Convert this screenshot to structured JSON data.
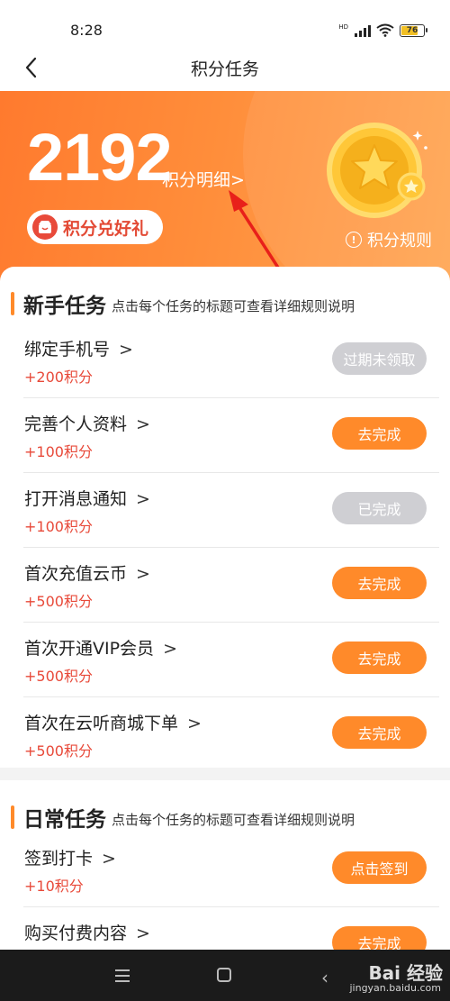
{
  "status_bar": {
    "time": "8:28",
    "battery": "76",
    "battery_level": 0.76,
    "network": "HD"
  },
  "nav": {
    "title": "积分任务"
  },
  "hero": {
    "points": "2192",
    "detail_link": "积分明细>",
    "gift_button": "积分兑好礼",
    "rules_link": "积分规则"
  },
  "sections": [
    {
      "title": "新手任务",
      "subtitle": "点击每个任务的标题可查看详细规则说明",
      "tasks": [
        {
          "title": "绑定手机号",
          "points": "+200积分",
          "button": "过期未领取",
          "state": "disabled"
        },
        {
          "title": "完善个人资料",
          "points": "+100积分",
          "button": "去完成",
          "state": "active"
        },
        {
          "title": "打开消息通知",
          "points": "+100积分",
          "button": "已完成",
          "state": "disabled"
        },
        {
          "title": "首次充值云币",
          "points": "+500积分",
          "button": "去完成",
          "state": "active"
        },
        {
          "title": "首次开通VIP会员",
          "points": "+500积分",
          "button": "去完成",
          "state": "active"
        },
        {
          "title": "首次在云听商城下单",
          "points": "+500积分",
          "button": "去完成",
          "state": "active"
        }
      ]
    },
    {
      "title": "日常任务",
      "subtitle": "点击每个任务的标题可查看详细规则说明",
      "tasks": [
        {
          "title": "签到打卡",
          "points": "+10积分",
          "button": "点击签到",
          "state": "active"
        },
        {
          "title": "购买付费内容",
          "points": "",
          "button": "去完成",
          "state": "active"
        }
      ]
    }
  ],
  "watermark": {
    "brand": "Bai 经验",
    "url": "jingyan.baidu.com"
  },
  "colors": {
    "accent": "#ff8a2a",
    "points_red": "#e84a3a",
    "disabled": "#cfcfd3"
  }
}
